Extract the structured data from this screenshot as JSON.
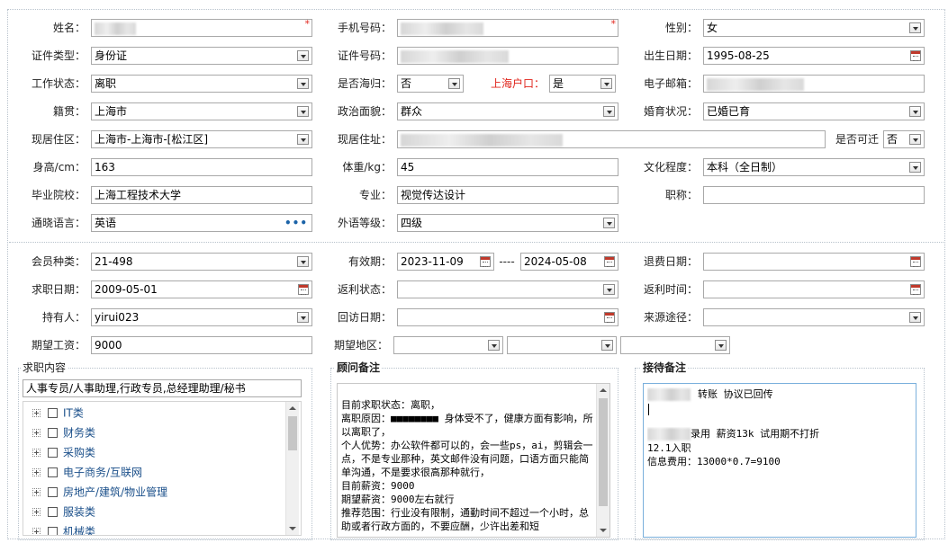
{
  "basic": {
    "name_label": "姓名：",
    "phone_label": "手机号码：",
    "gender_label": "性别：",
    "gender_value": "女",
    "idtype_label": "证件类型：",
    "idtype_value": "身份证",
    "idno_label": "证件号码：",
    "birth_label": "出生日期：",
    "birth_value": "1995-08-25",
    "workstatus_label": "工作状态：",
    "workstatus_value": "离职",
    "returnee_label": "是否海归：",
    "returnee_value": "否",
    "hukou_label": "上海户口：",
    "hukou_value": "是",
    "email_label": "电子邮箱：",
    "native_label": "籍贯：",
    "native_value": "上海市",
    "political_label": "政治面貌：",
    "political_value": "群众",
    "marital_label": "婚育状况：",
    "marital_value": "已婚已育",
    "residence_label": "现居住区：",
    "residence_value": "上海市-上海市-[松江区]",
    "address_label": "现居住址：",
    "relocate_label": "是否可迁",
    "relocate_value": "否",
    "height_label": "身高/cm：",
    "height_value": "163",
    "weight_label": "体重/kg：",
    "weight_value": "45",
    "education_label": "文化程度：",
    "education_value": "本科（全日制）",
    "school_label": "毕业院校：",
    "school_value": "上海工程技术大学",
    "major_label": "专业：",
    "major_value": "视觉传达设计",
    "title_label": "职称：",
    "language_label": "通晓语言：",
    "language_value": "英语",
    "language_dots": "•••",
    "forlevel_label": "外语等级：",
    "forlevel_value": "四级"
  },
  "member": {
    "type_label": "会员种类：",
    "type_value": "21-498",
    "valid_label": "有效期：",
    "valid_from": "2023-11-09",
    "valid_sep": "----",
    "valid_to": "2024-05-08",
    "refund_date_label": "退费日期：",
    "job_date_label": "求职日期：",
    "job_date_value": "2009-05-01",
    "rebate_status_label": "返利状态：",
    "rebate_time_label": "返利时间：",
    "holder_label": "持有人：",
    "holder_value": "yirui023",
    "visit_date_label": "回访日期：",
    "source_label": "来源途径：",
    "salary_label": "期望工资：",
    "salary_value": "9000",
    "area_label": "期望地区："
  },
  "job_panel": {
    "title": "求职内容",
    "selected": "人事专员/人事助理,行政专员,总经理助理/秘书",
    "items": [
      "IT类",
      "财务类",
      "采购类",
      "电子商务/互联网",
      "房地产/建筑/物业管理",
      "服装类",
      "机械类"
    ]
  },
  "advisor_panel": {
    "title": "顾问备注",
    "text": "目前求职状态：离职，\n离职原因：■■■■■■■■ 身体受不了，健康方面有影响，所以离职了，\n个人优势：办公软件都可以的，会一些ps，ai，剪辑会一点，不是专业那种，英文邮件没有问题，口语方面只能简单沟通，不是要求很高那种就行，\n目前薪资：9000\n期望薪资：9000左右就行\n推荐范围：行业没有限制，通勤时间不超过一个小时，总助或者行政方面的，不要应酬，少许出差和短"
  },
  "reception_panel": {
    "title": "接待备注",
    "line1": "转账 协议已回传",
    "line2": "录用 薪资13k 试用期不打折",
    "line3": "12.1入职",
    "line4": "信息费用：13000*0.7=9100"
  },
  "colors": {
    "required": "#e0241b",
    "link": "#1a4f8a",
    "border": "#a9a9a9"
  }
}
